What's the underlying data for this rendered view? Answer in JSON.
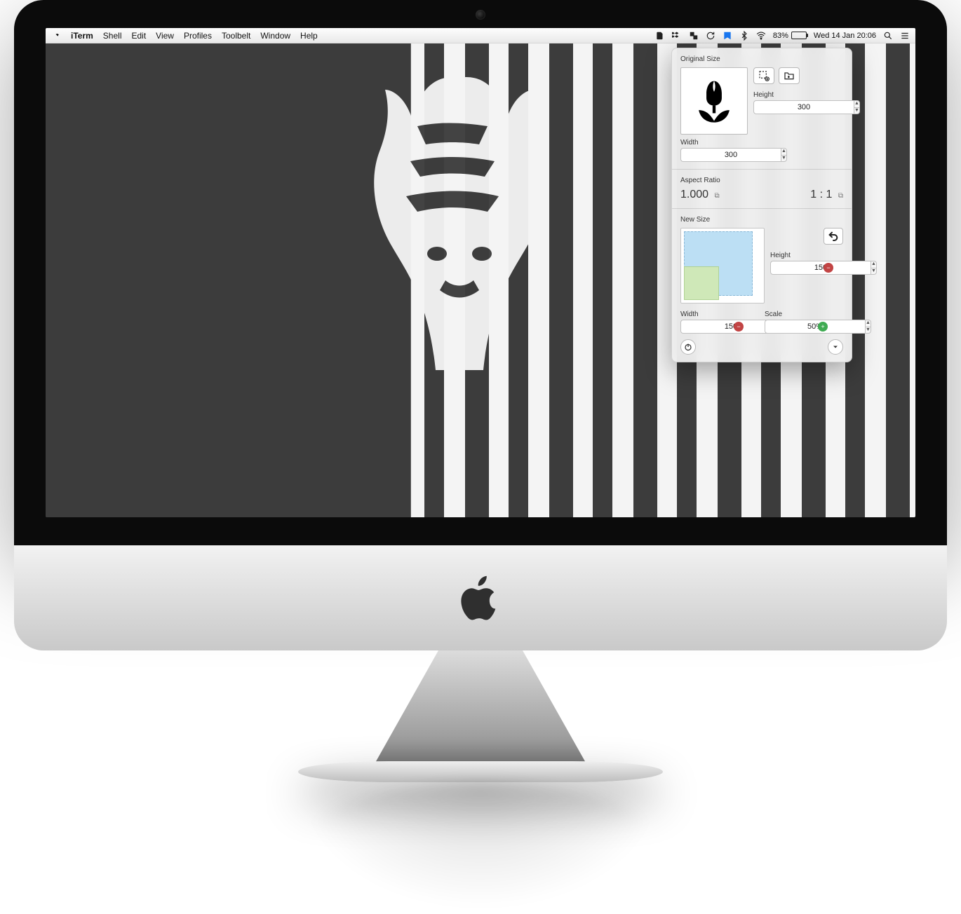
{
  "menubar": {
    "app_name": "iTerm",
    "items": [
      "Shell",
      "Edit",
      "View",
      "Profiles",
      "Toolbelt",
      "Window",
      "Help"
    ],
    "battery_percent": "83%",
    "clock": "Wed 14 Jan  20:06"
  },
  "panel": {
    "original": {
      "section_label": "Original Size",
      "width_label": "Width",
      "width_value": "300",
      "height_label": "Height",
      "height_value": "300"
    },
    "aspect": {
      "section_label": "Aspect Ratio",
      "ratio_decimal": "1.000",
      "ratio_text": "1 : 1"
    },
    "newsize": {
      "section_label": "New Size",
      "width_label": "Width",
      "width_value": "150",
      "height_label": "Height",
      "height_value": "150",
      "scale_label": "Scale",
      "scale_value": "50%"
    }
  }
}
